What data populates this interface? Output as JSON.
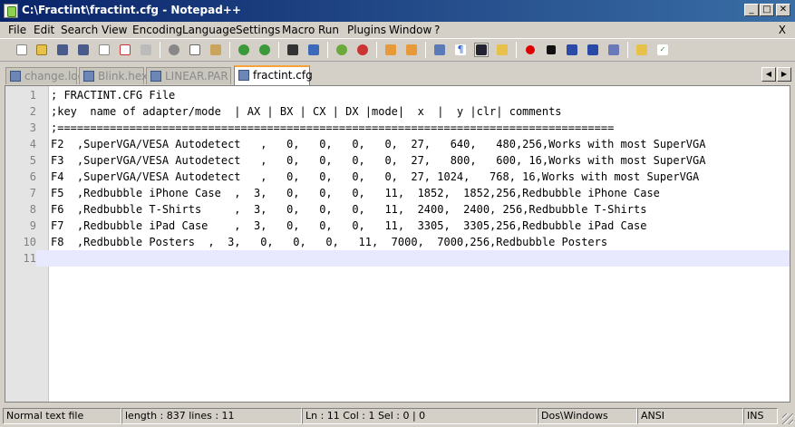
{
  "window": {
    "title": "C:\\Fractint\\fractint.cfg - Notepad++"
  },
  "menu": {
    "items": [
      "File",
      "Edit",
      "Search",
      "View",
      "Encoding",
      "Language",
      "Settings",
      "Macro",
      "Run",
      "Plugins",
      "Window",
      "?"
    ],
    "close_doc": "X"
  },
  "tabs": [
    {
      "label": "change.log"
    },
    {
      "label": "Blink.hex"
    },
    {
      "label": "LINEAR.PAR"
    },
    {
      "label": "fractint.cfg"
    }
  ],
  "editor": {
    "lines": [
      {
        "num": "1",
        "text": "; FRACTINT.CFG File"
      },
      {
        "num": "2",
        "text": ";key  name of adapter/mode  | AX | BX | CX | DX |mode|  x  |  y |clr| comments"
      },
      {
        "num": "3",
        "text": ";====================================================================================="
      },
      {
        "num": "4",
        "text": "F2  ,SuperVGA/VESA Autodetect   ,   0,   0,   0,   0,  27,   640,   480,256,Works with most SuperVGA"
      },
      {
        "num": "5",
        "text": "F3  ,SuperVGA/VESA Autodetect   ,   0,   0,   0,   0,  27,   800,   600, 16,Works with most SuperVGA"
      },
      {
        "num": "6",
        "text": "F4  ,SuperVGA/VESA Autodetect   ,   0,   0,   0,   0,  27, 1024,   768, 16,Works with most SuperVGA"
      },
      {
        "num": "7",
        "text": "F5  ,Redbubble iPhone Case  ,  3,   0,   0,   0,   11,  1852,  1852,256,Redbubble iPhone Case"
      },
      {
        "num": "8",
        "text": "F6  ,Redbubble T-Shirts     ,  3,   0,   0,   0,   11,  2400,  2400, 256,Redbubble T-Shirts"
      },
      {
        "num": "9",
        "text": "F7  ,Redbubble iPad Case    ,  3,   0,   0,   0,   11,  3305,  3305,256,Redbubble iPad Case"
      },
      {
        "num": "10",
        "text": "F8  ,Redbubble Posters  ,  3,   0,   0,   0,   11,  7000,  7000,256,Redbubble Posters"
      },
      {
        "num": "11",
        "text": ""
      }
    ]
  },
  "status": {
    "file_type": "Normal text file",
    "length": "length : 837   lines : 11",
    "position": "Ln : 11   Col : 1   Sel : 0 | 0",
    "eol": "Dos\\Windows",
    "encoding": "ANSI",
    "mode": "INS"
  },
  "colors": {
    "titlebar_start": "#0a246a",
    "active_tab_accent": "#f7a23a",
    "current_line": "#e8e8ff"
  },
  "toolbar_icons": [
    "new-file-icon",
    "open-file-icon",
    "save-icon",
    "save-all-icon",
    "close-icon",
    "close-all-icon",
    "print-icon",
    "cut-icon",
    "copy-icon",
    "paste-icon",
    "undo-icon",
    "redo-icon",
    "find-icon",
    "replace-icon",
    "zoom-in-icon",
    "zoom-out-icon",
    "sync-vertical-icon",
    "sync-horizontal-icon",
    "word-wrap-icon",
    "show-all-chars-icon",
    "indent-guide-icon",
    "user-define-icon",
    "record-macro-icon",
    "stop-record-icon",
    "play-macro-icon",
    "play-multiple-icon",
    "save-macro-icon",
    "open-folder-icon",
    "spell-check-icon"
  ]
}
